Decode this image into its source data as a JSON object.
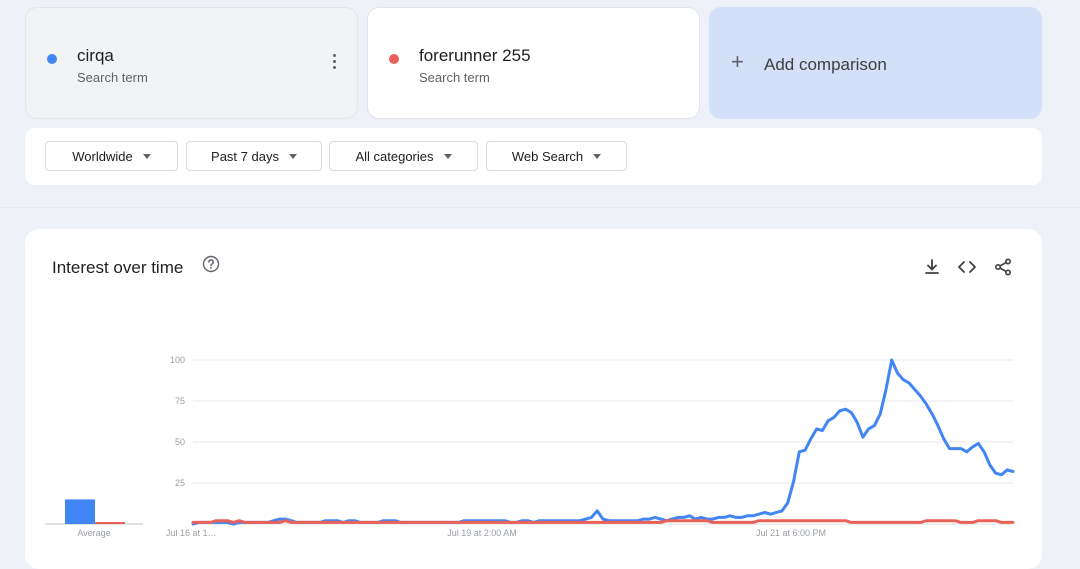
{
  "terms": [
    {
      "name": "cirqa",
      "sub": "Search term",
      "color": "#4285f4"
    },
    {
      "name": "forerunner 255",
      "sub": "Search term",
      "color": "#e8625a"
    }
  ],
  "add_comparison": {
    "icon": "plus-icon",
    "label": "Add comparison"
  },
  "filters": {
    "region": "Worldwide",
    "time": "Past 7 days",
    "category": "All categories",
    "search_type": "Web Search"
  },
  "panel": {
    "title": "Interest over time",
    "icons": [
      "help-icon",
      "download-icon",
      "embed-code-icon",
      "share-icon"
    ]
  },
  "chart_data": {
    "type": "line",
    "title": "",
    "ylabel": "",
    "xlabel": "",
    "ylim": [
      0,
      100
    ],
    "y_ticks": [
      25,
      50,
      75,
      100
    ],
    "x_tick_labels": [
      "Jul 16 at 1…",
      "Jul 19 at 2:00 AM",
      "Jul 21 at 6:00 PM"
    ],
    "average_label": "Average",
    "averages": [
      {
        "name": "cirqa",
        "value": 15
      },
      {
        "name": "forerunner 255",
        "value": 1
      }
    ],
    "series": [
      {
        "name": "cirqa",
        "color": "#4285f4",
        "values": [
          0,
          1,
          1,
          1,
          1,
          1,
          1,
          0,
          1,
          1,
          1,
          1,
          1,
          1,
          2,
          3,
          3,
          2,
          1,
          1,
          1,
          1,
          1,
          2,
          2,
          2,
          1,
          2,
          2,
          1,
          1,
          1,
          1,
          2,
          2,
          2,
          1,
          1,
          1,
          1,
          1,
          1,
          1,
          1,
          1,
          1,
          1,
          2,
          2,
          2,
          2,
          2,
          2,
          2,
          2,
          1,
          1,
          2,
          2,
          1,
          2,
          2,
          2,
          2,
          2,
          2,
          2,
          2,
          3,
          4,
          8,
          3,
          2,
          2,
          2,
          2,
          2,
          2,
          3,
          3,
          4,
          3,
          2,
          3,
          4,
          4,
          5,
          3,
          4,
          3,
          3,
          4,
          4,
          5,
          4,
          4,
          5,
          5,
          6,
          7,
          6,
          7,
          8,
          13,
          26,
          44,
          45,
          52,
          58,
          57,
          63,
          65,
          69,
          70,
          68,
          62,
          53,
          58,
          60,
          67,
          82,
          100,
          92,
          88,
          86,
          82,
          78,
          73,
          67,
          60,
          52,
          46,
          46,
          46,
          44,
          47,
          49,
          44,
          36,
          31,
          30,
          33,
          32
        ]
      },
      {
        "name": "forerunner 255",
        "color": "#e8625a",
        "values": [
          1,
          1,
          1,
          1,
          2,
          2,
          2,
          1,
          2,
          1,
          1,
          1,
          1,
          1,
          1,
          1,
          2,
          1,
          1,
          1,
          1,
          1,
          1,
          1,
          1,
          1,
          1,
          1,
          1,
          1,
          1,
          1,
          1,
          1,
          1,
          1,
          1,
          1,
          1,
          1,
          1,
          1,
          1,
          1,
          1,
          1,
          1,
          1,
          1,
          1,
          1,
          1,
          1,
          1,
          1,
          1,
          1,
          1,
          1,
          1,
          1,
          1,
          1,
          1,
          1,
          1,
          1,
          1,
          1,
          1,
          1,
          1,
          1,
          1,
          1,
          1,
          1,
          1,
          1,
          1,
          1,
          1,
          2,
          2,
          2,
          2,
          2,
          2,
          2,
          2,
          1,
          1,
          1,
          1,
          1,
          1,
          1,
          1,
          2,
          2,
          2,
          2,
          2,
          2,
          2,
          2,
          2,
          2,
          2,
          2,
          2,
          2,
          2,
          2,
          1,
          1,
          1,
          1,
          1,
          1,
          1,
          1,
          1,
          1,
          1,
          1,
          1,
          2,
          2,
          2,
          2,
          2,
          2,
          1,
          1,
          1,
          2,
          2,
          2,
          2,
          1,
          1,
          1
        ]
      }
    ]
  }
}
